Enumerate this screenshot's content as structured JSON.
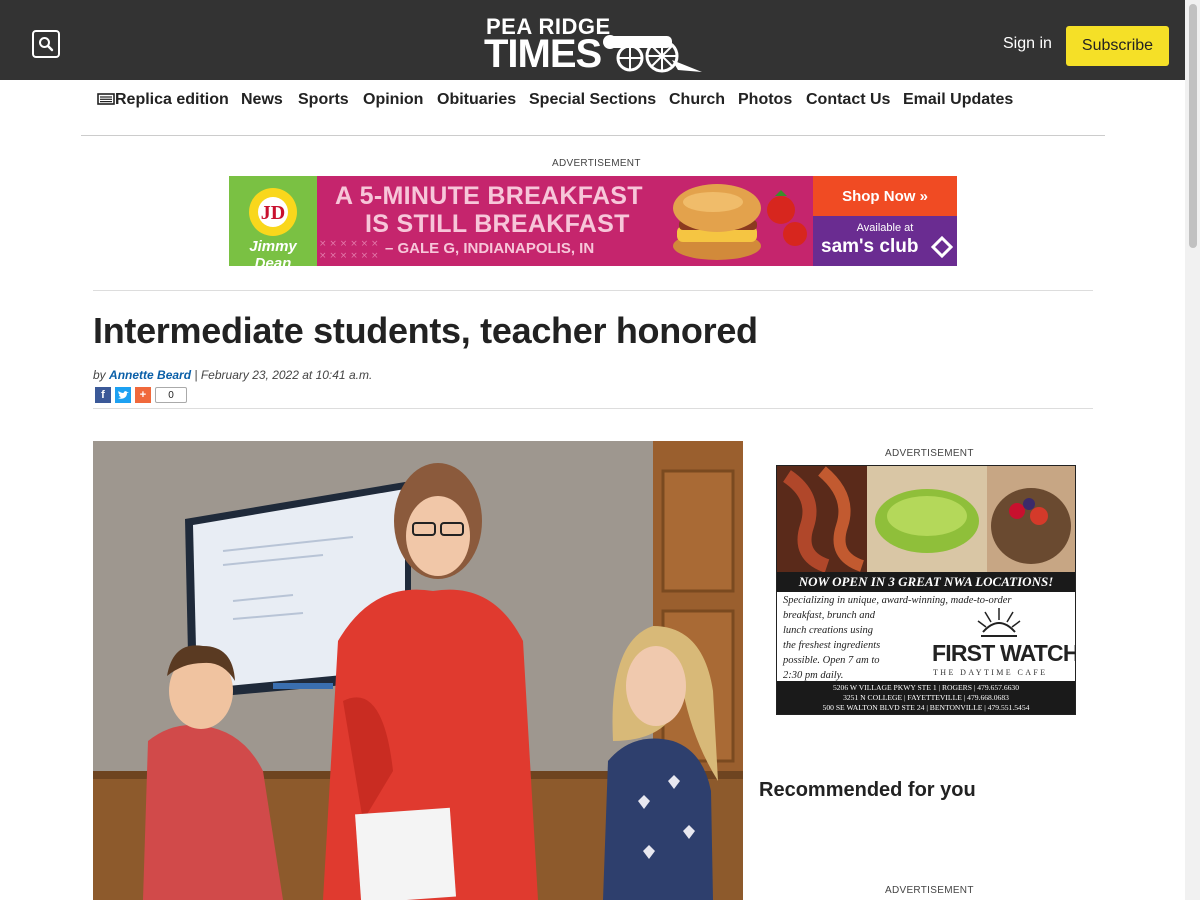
{
  "header": {
    "logo_line1": "PEA RIDGE",
    "logo_line2": "TIMES",
    "sign_in": "Sign in",
    "subscribe": "Subscribe",
    "search_icon": "search-icon"
  },
  "nav": {
    "items": [
      "Replica edition",
      "News",
      "Sports",
      "Opinion",
      "Obituaries",
      "Special Sections",
      "Church",
      "Photos",
      "Contact Us",
      "Email Updates"
    ]
  },
  "ad_label": "ADVERTISEMENT",
  "banner_ad": {
    "brand": "Jimmy Dean",
    "line1": "A 5-MINUTE BREAKFAST",
    "line2": "IS STILL BREAKFAST",
    "attribution": "– GALE G, INDIANAPOLIS, IN",
    "cta": "Shop Now »",
    "available": "Available at",
    "retailer": "sam's club",
    "bg_color": "#c5256d",
    "cta_color": "#f04b23",
    "retailer_color": "#6a2c91"
  },
  "article": {
    "headline": "Intermediate students, teacher honored",
    "by": "by",
    "author": "Annette Beard",
    "date": "| February 23, 2022 at 10:41 a.m.",
    "share_count": "0"
  },
  "side_ad": {
    "headline": "NOW OPEN IN 3 GREAT NWA LOCATIONS!",
    "body": [
      "Specializing in unique, award-winning, made-to-order",
      "breakfast, brunch and",
      "lunch creations using",
      "the freshest ingredients",
      "possible. Open 7 am to",
      "2:30 pm daily."
    ],
    "brand": "FIRST WATCH",
    "tagline": "THE DAYTIME CAFE",
    "locations": [
      "5206 W VILLAGE PKWY STE 1 | ROGERS | 479.657.6630",
      "3251 N COLLEGE | FAYETTEVILLE | 479.668.0683",
      "500 SE WALTON BLVD STE 24 | BENTONVILLE | 479.551.5454"
    ]
  },
  "sidebar": {
    "recommended": "Recommended for you"
  }
}
